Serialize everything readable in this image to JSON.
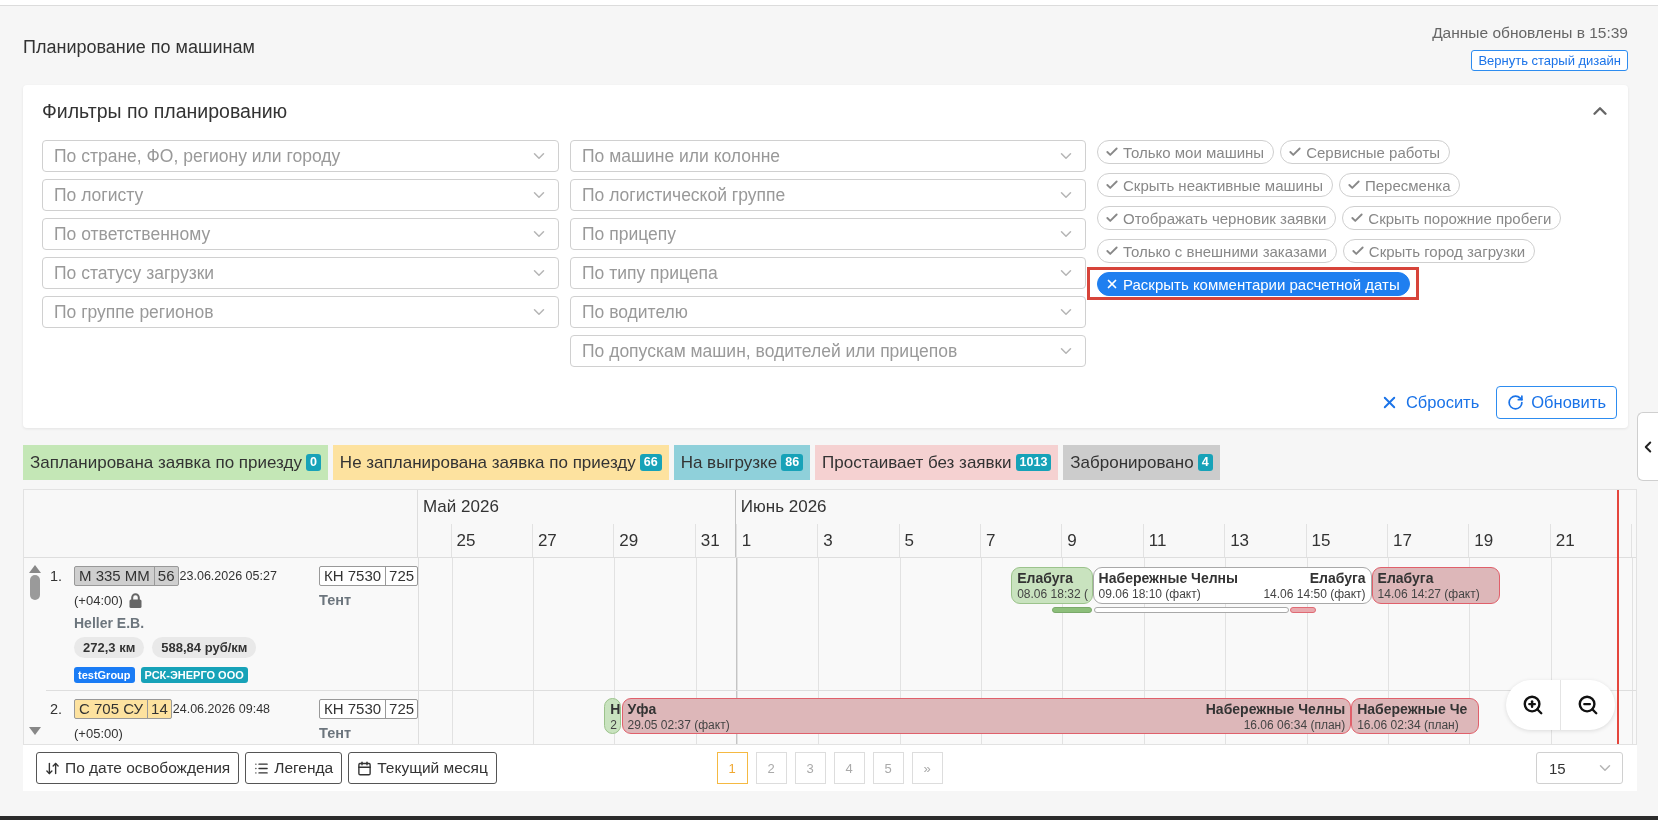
{
  "header": {
    "title": "Планирование по машинам",
    "updated": "Данные обновлены в 15:39",
    "old_design_button": "Вернуть старый дизайн"
  },
  "filters": {
    "title": "Фильтры по планированию",
    "expanded": true,
    "selects": [
      [
        {
          "placeholder": "По стране, ФО, региону или городу"
        },
        {
          "placeholder": "По логисту"
        },
        {
          "placeholder": "По ответственному"
        },
        {
          "placeholder": "По статусу загрузки"
        },
        {
          "placeholder": "По группе регионов"
        }
      ],
      [
        {
          "placeholder": "По машине или колонне"
        },
        {
          "placeholder": "По логистической группе"
        },
        {
          "placeholder": "По прицепу"
        },
        {
          "placeholder": "По типу прицепа"
        },
        {
          "placeholder": "По водителю"
        },
        {
          "placeholder": "По допускам машин, водителей или прицепов"
        }
      ]
    ],
    "toggles": [
      {
        "label": "Только мои машины",
        "selected": false,
        "highlighted": false
      },
      {
        "label": "Сервисные работы",
        "selected": false,
        "highlighted": false
      },
      {
        "label": "Скрыть неактивные машины",
        "selected": false,
        "highlighted": false
      },
      {
        "label": "Пересменка",
        "selected": false,
        "highlighted": false
      },
      {
        "label": "Отображать черновик заявки",
        "selected": false,
        "highlighted": false
      },
      {
        "label": "Скрыть порожние пробеги",
        "selected": false,
        "highlighted": false
      },
      {
        "label": "Только с внешними заказами",
        "selected": false,
        "highlighted": false
      },
      {
        "label": "Скрыть город загрузки",
        "selected": false,
        "highlighted": false
      },
      {
        "label": "Раскрыть комментарии расчетной даты",
        "selected": true,
        "highlighted": true
      }
    ],
    "reset_button": "Сбросить",
    "refresh_button": "Обновить"
  },
  "legend": [
    {
      "label": "Запланирована заявка по приезду",
      "count": "0",
      "color": "#c4e7b6"
    },
    {
      "label": "Не запланирована заявка по приезду",
      "count": "66",
      "color": "#fde29f"
    },
    {
      "label": "На выгрузке",
      "count": "86",
      "color": "#8fd0da"
    },
    {
      "label": "Простаивает без заявки",
      "count": "1013",
      "color": "#f5d1d1"
    },
    {
      "label": "Забронировано",
      "count": "4",
      "color": "#cccccc"
    }
  ],
  "timeline": {
    "months": [
      {
        "label": "Май 2026",
        "days": [
          "25",
          "27",
          "29",
          "31"
        ]
      },
      {
        "label": "Июнь 2026",
        "days": [
          "1",
          "3",
          "5",
          "7",
          "9",
          "11",
          "13",
          "15",
          "17",
          "19",
          "21"
        ]
      }
    ],
    "rows": [
      {
        "number": "1.",
        "plate": {
          "number": "М 335 ММ",
          "region": "56",
          "color": "#cfcfcf"
        },
        "date": "23.06.2026 05:27",
        "timezone": "(+04:00)",
        "locked": true,
        "driver": "Heller E.B.",
        "stats": [
          "272,3 км",
          "588,84 руб/км"
        ],
        "tags": [
          {
            "label": "testGroup",
            "color": "#1a7cf5"
          },
          {
            "label": "РСК-ЭНЕРГО ООО",
            "color": "#17a2b8"
          }
        ],
        "trailer": {
          "number": "КН 7530",
          "region": "725"
        },
        "body_type": "Тент",
        "trips": [
          {
            "kind": "planned",
            "start": {
              "city": "Елабуга",
              "time": "08.06 18:32 ("
            }
          },
          {
            "kind": "trip",
            "start": {
              "city": "Набережные Челны",
              "time": "09.06 18:10 (факт)"
            },
            "end": {
              "city": "Елабуга",
              "time": "14.06 14:50 (факт)"
            }
          },
          {
            "kind": "idle",
            "start": {
              "city": "Елабуга",
              "time": "14.06 14:27 (факт)"
            }
          }
        ],
        "segments": [
          {
            "kind": "planned"
          },
          {
            "kind": "trip"
          },
          {
            "kind": "idle"
          }
        ]
      },
      {
        "number": "2.",
        "plate": {
          "number": "С 705 СУ",
          "region": "14",
          "color": "#fde29f"
        },
        "date": "24.06.2026 09:48",
        "timezone": "(+05:00)",
        "locked": false,
        "trailer": {
          "number": "КН 7530",
          "region": "725"
        },
        "body_type": "Тент",
        "trips": [
          {
            "kind": "planned",
            "start": {
              "city": "Н",
              "time": "2"
            }
          },
          {
            "kind": "idle",
            "start": {
              "city": "Уфа",
              "time": "29.05 02:37 (факт)"
            },
            "end": {
              "city": "Набережные Челны",
              "time": "16.06 06:34 (план)"
            }
          },
          {
            "kind": "idle",
            "start": {
              "city": "Набережные Че",
              "time": "16.06 02:34 (план)"
            }
          }
        ]
      }
    ]
  },
  "footer_buttons": [
    {
      "label": "По дате освобождения",
      "kind": "sort"
    },
    {
      "label": "Легенда",
      "kind": "legend"
    },
    {
      "label": "Текущий месяц",
      "kind": "calendar"
    }
  ],
  "pagination": {
    "pages": [
      {
        "label": "1",
        "selected": true
      },
      {
        "label": "2",
        "selected": false
      },
      {
        "label": "3",
        "selected": false
      },
      {
        "label": "4",
        "selected": false
      },
      {
        "label": "5",
        "selected": false
      }
    ],
    "next": "»",
    "page_size": "15"
  }
}
